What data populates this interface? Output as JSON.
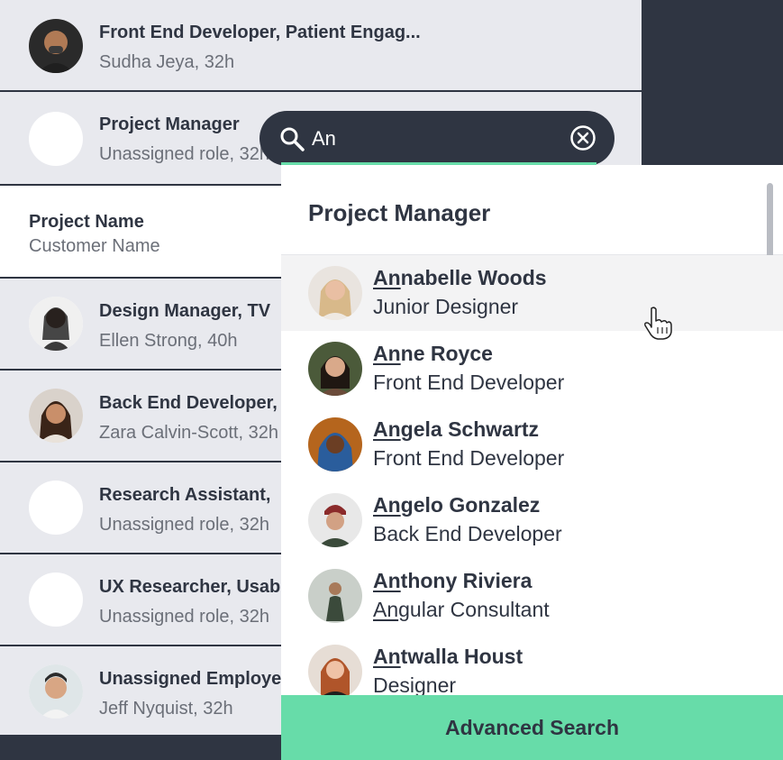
{
  "rows": [
    {
      "title": "Front End Developer, Patient Engag...",
      "sub": "Sudha Jeya, 32h",
      "avatar_icon": "person-photo"
    },
    {
      "title": "Project Manager",
      "sub": "Unassigned role, 32h",
      "avatar_icon": "empty-avatar"
    },
    {
      "title": "Project Name",
      "sub": "Customer Name"
    },
    {
      "title": "Design Manager, TV",
      "sub": "Ellen Strong, 40h",
      "avatar_icon": "person-photo"
    },
    {
      "title": "Back End Developer,",
      "sub": "Zara Calvin-Scott, 32h",
      "avatar_icon": "person-photo"
    },
    {
      "title": "Research Assistant,",
      "sub": "Unassigned role, 32h",
      "avatar_icon": "empty-avatar"
    },
    {
      "title": "UX Researcher, Usab",
      "sub": "Unassigned role, 32h",
      "avatar_icon": "empty-avatar"
    },
    {
      "title": "Unassigned Employe",
      "sub": "Jeff Nyquist, 32h",
      "avatar_icon": "person-photo"
    }
  ],
  "search": {
    "value": "An",
    "icon": "search-icon",
    "clear_icon": "clear-icon"
  },
  "dropdown": {
    "heading": "Project Manager",
    "match": "An",
    "options": [
      {
        "name_rest": "nabelle Woods",
        "role": "Junior Designer",
        "role_match": ""
      },
      {
        "name_rest": "ne Royce",
        "role": "Front End Developer",
        "role_match": ""
      },
      {
        "name_rest": "gela Schwartz",
        "role": "Front End Developer",
        "role_match": ""
      },
      {
        "name_rest": "gelo Gonzalez",
        "role": "Back End Developer",
        "role_match": ""
      },
      {
        "name_rest": "thony Riviera",
        "role": "gular Consultant",
        "role_match": "An"
      },
      {
        "name_rest": "twalla Houst",
        "role": "Designer",
        "role_match": ""
      }
    ]
  },
  "advanced_search_label": "Advanced Search",
  "colors": {
    "dark": "#2f3542",
    "accent": "#67dca9",
    "row_bg": "#e8e9ee",
    "white": "#ffffff"
  }
}
